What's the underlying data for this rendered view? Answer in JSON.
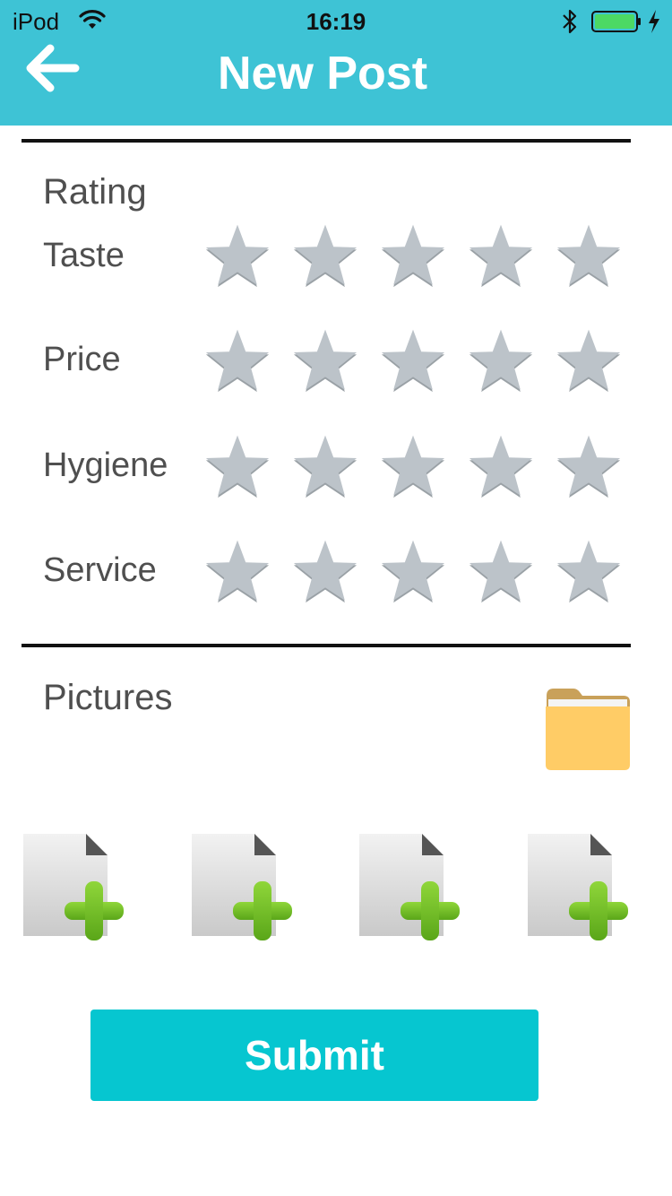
{
  "status_bar": {
    "carrier": "iPod",
    "time": "16:19"
  },
  "header": {
    "title": "New Post",
    "accent_color": "#3ec3d5"
  },
  "rating": {
    "heading": "Rating",
    "max_stars": 5,
    "rows": [
      {
        "label": "Taste",
        "value": 0
      },
      {
        "label": "Price",
        "value": 0
      },
      {
        "label": "Hygiene",
        "value": 0
      },
      {
        "label": "Service",
        "value": 0
      }
    ]
  },
  "pictures": {
    "heading": "Pictures",
    "folder_icon": "folder-icon",
    "slots": [
      "add-image-icon",
      "add-image-icon",
      "add-image-icon",
      "add-image-icon"
    ]
  },
  "submit": {
    "label": "Submit",
    "color": "#06c6d0"
  }
}
